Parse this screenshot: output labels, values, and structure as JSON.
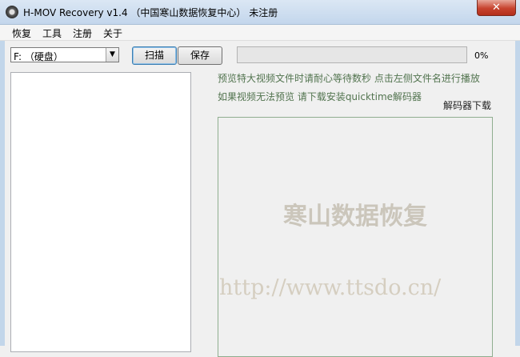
{
  "window": {
    "title": "H-MOV Recovery v1.4 （中国寒山数据恢复中心） 未注册",
    "close_label": "✕"
  },
  "menu": [
    "恢复",
    "工具",
    "注册",
    "关于"
  ],
  "toolbar": {
    "drive": "F: （硬盘）",
    "dropdown_arrow": "▼",
    "scan_label": "扫描",
    "save_label": "保存",
    "progress_value": 0,
    "progress_text": "0%"
  },
  "info": {
    "line1": "预览特大视频文件时请耐心等待数秒 点击左侧文件名进行播放",
    "line2": "如果视频无法预览 请下载安装quicktime解码器",
    "decoder_link": "解码器下载"
  },
  "preview": {
    "watermark_name": "寒山数据恢复",
    "watermark_url": "http://www.ttsdo.cn/"
  }
}
